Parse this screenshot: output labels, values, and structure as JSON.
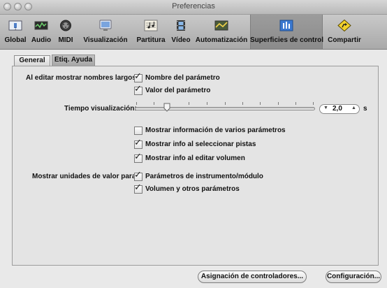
{
  "window": {
    "title": "Preferencias"
  },
  "toolbar": {
    "items": [
      {
        "label": "Global",
        "icon": "global-prefs-icon",
        "selected": false
      },
      {
        "label": "Audio",
        "icon": "audio-meter-icon",
        "selected": false
      },
      {
        "label": "MIDI",
        "icon": "midi-connector-icon",
        "selected": false
      },
      {
        "label": "Visualización",
        "icon": "display-monitor-icon",
        "selected": false
      },
      {
        "label": "Partitura",
        "icon": "score-notes-icon",
        "selected": false
      },
      {
        "label": "Vídeo",
        "icon": "film-strip-icon",
        "selected": false
      },
      {
        "label": "Automatización",
        "icon": "automation-curve-icon",
        "selected": false
      },
      {
        "label": "Superficies de control",
        "icon": "control-surface-icon",
        "selected": true
      },
      {
        "label": "Compartir",
        "icon": "share-icon",
        "selected": false
      }
    ]
  },
  "tabs": [
    {
      "label": "General",
      "active": false
    },
    {
      "label": "Etiq. Ayuda",
      "active": true
    }
  ],
  "long_names": {
    "label": "Al editar mostrar nombres largos",
    "options": [
      {
        "label": "Nombre del parámetro",
        "checked": true
      },
      {
        "label": "Valor del parámetro",
        "checked": true
      }
    ]
  },
  "display_time": {
    "label": "Tiempo visualización:",
    "value": "2,0",
    "unit": "s",
    "slider_fraction": 0.18
  },
  "info_options": [
    {
      "label": "Mostrar información de varios parámetros",
      "checked": false
    },
    {
      "label": "Mostrar info al seleccionar pistas",
      "checked": true
    },
    {
      "label": "Mostrar info al editar volumen",
      "checked": true
    }
  ],
  "value_units": {
    "label": "Mostrar unidades de valor para:",
    "options": [
      {
        "label": "Parámetros de instrumento/módulo",
        "checked": true
      },
      {
        "label": "Volumen y otros parámetros",
        "checked": true
      }
    ]
  },
  "buttons": {
    "controller_assignments": "Asignación de controladores...",
    "setup": "Configuración..."
  },
  "colors": {
    "checkmark": "#222222",
    "selected_tab": "#a6a6a6"
  }
}
